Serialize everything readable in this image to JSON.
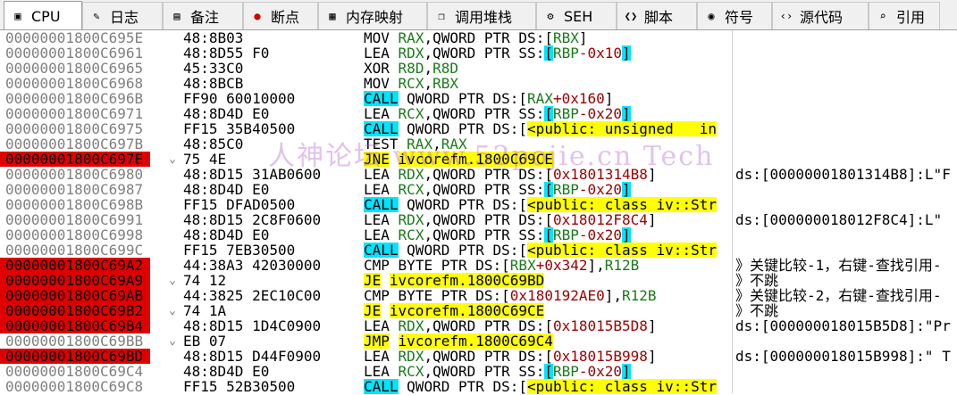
{
  "tabs": [
    {
      "label": "CPU",
      "icon": "cpu-icon",
      "active": true
    },
    {
      "label": "日志",
      "icon": "log-icon"
    },
    {
      "label": "备注",
      "icon": "notes-icon"
    },
    {
      "label": "断点",
      "icon": "breakpoint-icon"
    },
    {
      "label": "内存映射",
      "icon": "memory-map-icon"
    },
    {
      "label": "调用堆栈",
      "icon": "call-stack-icon"
    },
    {
      "label": "SEH",
      "icon": "seh-icon"
    },
    {
      "label": "脚本",
      "icon": "script-icon"
    },
    {
      "label": "符号",
      "icon": "symbols-icon"
    },
    {
      "label": "源代码",
      "icon": "source-icon"
    },
    {
      "label": "引用",
      "icon": "references-icon"
    }
  ],
  "watermark": "人神论坛 www.52pojie.cn  Tech",
  "rows": [
    {
      "addr": "00000001800C695E",
      "bp": false,
      "arrow": "",
      "bytes": "48:8B03",
      "mn": "MOV",
      "mt": "",
      "ops": [
        [
          "reg",
          "RAX"
        ],
        [
          "p",
          ","
        ],
        [
          "kw",
          "QWORD PTR "
        ],
        [
          "seg",
          "DS:"
        ],
        [
          "p",
          "["
        ],
        [
          "reg",
          "RBX"
        ],
        [
          "p",
          "]"
        ]
      ],
      "comment": ""
    },
    {
      "addr": "00000001800C6961",
      "bp": false,
      "arrow": "",
      "bytes": "48:8D55 F0",
      "mn": "LEA",
      "mt": "",
      "ops": [
        [
          "reg",
          "RDX"
        ],
        [
          "p",
          ","
        ],
        [
          "kw",
          "QWORD PTR "
        ],
        [
          "seg",
          "SS:"
        ],
        [
          "call",
          "["
        ],
        [
          "reg",
          "RBP"
        ],
        [
          "num",
          "-0x10"
        ],
        [
          "call",
          "]"
        ]
      ],
      "comment": ""
    },
    {
      "addr": "00000001800C6965",
      "bp": false,
      "arrow": "",
      "bytes": "45:33C0",
      "mn": "XOR",
      "mt": "",
      "ops": [
        [
          "reg",
          "R8D"
        ],
        [
          "p",
          ","
        ],
        [
          "reg",
          "R8D"
        ]
      ],
      "comment": ""
    },
    {
      "addr": "00000001800C6968",
      "bp": false,
      "arrow": "",
      "bytes": "48:8BCB",
      "mn": "MOV",
      "mt": "",
      "ops": [
        [
          "reg",
          "RCX"
        ],
        [
          "p",
          ","
        ],
        [
          "reg",
          "RBX"
        ]
      ],
      "comment": ""
    },
    {
      "addr": "00000001800C696B",
      "bp": false,
      "arrow": "",
      "bytes": "FF90 60010000",
      "mn": "CALL",
      "mt": "call",
      "ops": [
        [
          "kw",
          "QWORD PTR "
        ],
        [
          "seg",
          "DS:"
        ],
        [
          "p",
          "["
        ],
        [
          "reg",
          "RAX"
        ],
        [
          "num",
          "+0x160"
        ],
        [
          "p",
          "]"
        ]
      ],
      "comment": ""
    },
    {
      "addr": "00000001800C6971",
      "bp": false,
      "arrow": "",
      "bytes": "48:8D4D E0",
      "mn": "LEA",
      "mt": "",
      "ops": [
        [
          "reg",
          "RCX"
        ],
        [
          "p",
          ","
        ],
        [
          "kw",
          "QWORD PTR "
        ],
        [
          "seg",
          "SS:"
        ],
        [
          "call",
          "["
        ],
        [
          "reg",
          "RBP"
        ],
        [
          "num",
          "-0x20"
        ],
        [
          "call",
          "]"
        ]
      ],
      "comment": ""
    },
    {
      "addr": "00000001800C6975",
      "bp": false,
      "arrow": "",
      "bytes": "FF15 35B40500",
      "mn": "CALL",
      "mt": "call",
      "ops": [
        [
          "kw",
          "QWORD PTR "
        ],
        [
          "seg",
          "DS:"
        ],
        [
          "p",
          "["
        ],
        [
          "hl",
          "<public: unsigned __in"
        ]
      ],
      "comment": ""
    },
    {
      "addr": "00000001800C697B",
      "bp": false,
      "arrow": "",
      "bytes": "48:85C0",
      "mn": "TEST",
      "mt": "",
      "ops": [
        [
          "reg",
          "RAX"
        ],
        [
          "p",
          ","
        ],
        [
          "reg",
          "RAX"
        ]
      ],
      "comment": ""
    },
    {
      "addr": "00000001800C697E",
      "bp": true,
      "arrow": "⌄",
      "bytes": "75 4E",
      "mn": "JNE",
      "mt": "jmp",
      "ops": [
        [
          "hl",
          "ivcorefm.1800C69CE"
        ]
      ],
      "comment": ""
    },
    {
      "addr": "00000001800C6980",
      "bp": false,
      "arrow": "",
      "bytes": "48:8D15 31AB0600",
      "mn": "LEA",
      "mt": "",
      "ops": [
        [
          "reg",
          "RDX"
        ],
        [
          "p",
          ","
        ],
        [
          "kw",
          "QWORD PTR "
        ],
        [
          "seg",
          "DS:"
        ],
        [
          "p",
          "["
        ],
        [
          "num",
          "0x1801314B8"
        ],
        [
          "p",
          "]"
        ]
      ],
      "comment": "ds:[00000001801314B8]:L\"F"
    },
    {
      "addr": "00000001800C6987",
      "bp": false,
      "arrow": "",
      "bytes": "48:8D4D E0",
      "mn": "LEA",
      "mt": "",
      "ops": [
        [
          "reg",
          "RCX"
        ],
        [
          "p",
          ","
        ],
        [
          "kw",
          "QWORD PTR "
        ],
        [
          "seg",
          "SS:"
        ],
        [
          "call",
          "["
        ],
        [
          "reg",
          "RBP"
        ],
        [
          "num",
          "-0x20"
        ],
        [
          "call",
          "]"
        ]
      ],
      "comment": ""
    },
    {
      "addr": "00000001800C698B",
      "bp": false,
      "arrow": "",
      "bytes": "FF15 DFAD0500",
      "mn": "CALL",
      "mt": "call",
      "ops": [
        [
          "kw",
          "QWORD PTR "
        ],
        [
          "seg",
          "DS:"
        ],
        [
          "p",
          "["
        ],
        [
          "hl",
          "<public: class iv::Str"
        ]
      ],
      "comment": ""
    },
    {
      "addr": "00000001800C6991",
      "bp": false,
      "arrow": "",
      "bytes": "48:8D15 2C8F0600",
      "mn": "LEA",
      "mt": "",
      "ops": [
        [
          "reg",
          "RDX"
        ],
        [
          "p",
          ","
        ],
        [
          "kw",
          "QWORD PTR "
        ],
        [
          "seg",
          "DS:"
        ],
        [
          "p",
          "["
        ],
        [
          "num",
          "0x18012F8C4"
        ],
        [
          "p",
          "]"
        ]
      ],
      "comment": "ds:[000000018012F8C4]:L\""
    },
    {
      "addr": "00000001800C6998",
      "bp": false,
      "arrow": "",
      "bytes": "48:8D4D E0",
      "mn": "LEA",
      "mt": "",
      "ops": [
        [
          "reg",
          "RCX"
        ],
        [
          "p",
          ","
        ],
        [
          "kw",
          "QWORD PTR "
        ],
        [
          "seg",
          "SS:"
        ],
        [
          "call",
          "["
        ],
        [
          "reg",
          "RBP"
        ],
        [
          "num",
          "-0x20"
        ],
        [
          "call",
          "]"
        ]
      ],
      "comment": ""
    },
    {
      "addr": "00000001800C699C",
      "bp": false,
      "arrow": "",
      "bytes": "FF15 7EB30500",
      "mn": "CALL",
      "mt": "call",
      "ops": [
        [
          "kw",
          "QWORD PTR "
        ],
        [
          "seg",
          "DS:"
        ],
        [
          "p",
          "["
        ],
        [
          "hl",
          "<public: class iv::Str"
        ]
      ],
      "comment": ""
    },
    {
      "addr": "00000001800C69A2",
      "bp": true,
      "arrow": "",
      "bytes": "44:38A3 42030000",
      "mn": "CMP",
      "mt": "",
      "ops": [
        [
          "kw",
          "BYTE PTR "
        ],
        [
          "seg",
          "DS:"
        ],
        [
          "p",
          "["
        ],
        [
          "reg",
          "RBX"
        ],
        [
          "num",
          "+0x342"
        ],
        [
          "p",
          "],"
        ],
        [
          "reg",
          "R12B"
        ]
      ],
      "comment": "》关键比较-1，右键-查找引用-"
    },
    {
      "addr": "00000001800C69A9",
      "bp": true,
      "arrow": "⌄",
      "bytes": "74 12",
      "mn": "JE",
      "mt": "jmp",
      "ops": [
        [
          "hl",
          "ivcorefm.1800C69BD"
        ]
      ],
      "comment": "》不跳"
    },
    {
      "addr": "00000001800C69AB",
      "bp": true,
      "arrow": "",
      "bytes": "44:3825 2EC10C00",
      "mn": "CMP",
      "mt": "",
      "ops": [
        [
          "kw",
          "BYTE PTR "
        ],
        [
          "seg",
          "DS:"
        ],
        [
          "p",
          "["
        ],
        [
          "num",
          "0x180192AE0"
        ],
        [
          "p",
          "],"
        ],
        [
          "reg",
          "R12B"
        ]
      ],
      "comment": "》关键比较-2，右键-查找引用-"
    },
    {
      "addr": "00000001800C69B2",
      "bp": true,
      "arrow": "⌄",
      "bytes": "74 1A",
      "mn": "JE",
      "mt": "jmp",
      "ops": [
        [
          "hl",
          "ivcorefm.1800C69CE"
        ]
      ],
      "comment": "》不跳"
    },
    {
      "addr": "00000001800C69B4",
      "bp": true,
      "arrow": "",
      "bytes": "48:8D15 1D4C0900",
      "mn": "LEA",
      "mt": "",
      "ops": [
        [
          "reg",
          "RDX"
        ],
        [
          "p",
          ","
        ],
        [
          "kw",
          "QWORD PTR "
        ],
        [
          "seg",
          "DS:"
        ],
        [
          "p",
          "["
        ],
        [
          "num",
          "0x18015B5D8"
        ],
        [
          "p",
          "]"
        ]
      ],
      "comment": "ds:[000000018015B5D8]:\"Pr"
    },
    {
      "addr": "00000001800C69BB",
      "bp": false,
      "arrow": "⌄",
      "bytes": "EB 07",
      "mn": "JMP",
      "mt": "jmp",
      "ops": [
        [
          "hl",
          "ivcorefm.1800C69C4"
        ]
      ],
      "comment": ""
    },
    {
      "addr": "00000001800C69BD",
      "bp": true,
      "arrow": "",
      "bytes": "48:8D15 D44F0900",
      "mn": "LEA",
      "mt": "",
      "ops": [
        [
          "reg",
          "RDX"
        ],
        [
          "p",
          ","
        ],
        [
          "kw",
          "QWORD PTR "
        ],
        [
          "seg",
          "DS:"
        ],
        [
          "p",
          "["
        ],
        [
          "num",
          "0x18015B998"
        ],
        [
          "p",
          "]"
        ]
      ],
      "comment": "ds:[000000018015B998]:\" T"
    },
    {
      "addr": "00000001800C69C4",
      "bp": false,
      "arrow": "",
      "bytes": "48:8D4D E0",
      "mn": "LEA",
      "mt": "",
      "ops": [
        [
          "reg",
          "RCX"
        ],
        [
          "p",
          ","
        ],
        [
          "kw",
          "QWORD PTR "
        ],
        [
          "seg",
          "SS:"
        ],
        [
          "call",
          "["
        ],
        [
          "reg",
          "RBP"
        ],
        [
          "num",
          "-0x20"
        ],
        [
          "call",
          "]"
        ]
      ],
      "comment": ""
    },
    {
      "addr": "00000001800C69C8",
      "bp": false,
      "arrow": "",
      "bytes": "FF15 52B30500",
      "mn": "CALL",
      "mt": "call",
      "ops": [
        [
          "kw",
          "QWORD PTR "
        ],
        [
          "seg",
          "DS:"
        ],
        [
          "p",
          "["
        ],
        [
          "hl",
          "<public: class iv::Str"
        ]
      ],
      "comment": ""
    }
  ]
}
